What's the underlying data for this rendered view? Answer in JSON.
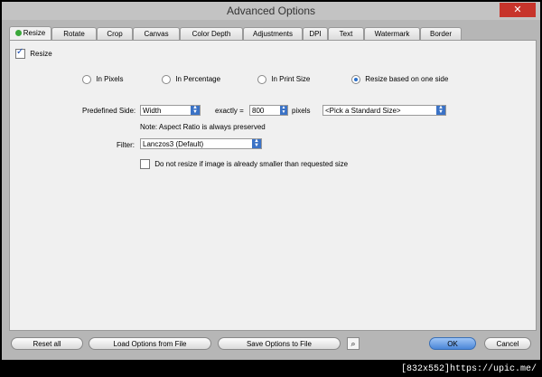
{
  "window": {
    "title": "Advanced Options",
    "close_label": "✕"
  },
  "tabs": [
    {
      "label": "Resize"
    },
    {
      "label": "Rotate"
    },
    {
      "label": "Crop"
    },
    {
      "label": "Canvas"
    },
    {
      "label": "Color Depth"
    },
    {
      "label": "Adjustments"
    },
    {
      "label": "DPI"
    },
    {
      "label": "Text"
    },
    {
      "label": "Watermark"
    },
    {
      "label": "Border"
    }
  ],
  "resize": {
    "enable_label": "Resize",
    "modes": [
      {
        "label": "In Pixels"
      },
      {
        "label": "In Percentage"
      },
      {
        "label": "In Print Size"
      },
      {
        "label": "Resize based on one side"
      }
    ],
    "predefined_side_label": "Predefined Side:",
    "predefined_side_value": "Width",
    "exactly_label": "exactly =",
    "exactly_value": "800",
    "pixels_label": "pixels",
    "standard_size_value": "<Pick a Standard Size>",
    "note": "Note: Aspect Ratio is always preserved",
    "filter_label": "Filter:",
    "filter_value": "Lanczos3 (Default)",
    "no_upscale_label": "Do not resize if image is already smaller than requested size"
  },
  "buttons": {
    "reset_all": "Reset all",
    "load_options": "Load Options from File",
    "save_options": "Save Options to File",
    "ok": "OK",
    "cancel": "Cancel"
  },
  "footer": {
    "watermark": "[832x552]https://upic.me/"
  }
}
